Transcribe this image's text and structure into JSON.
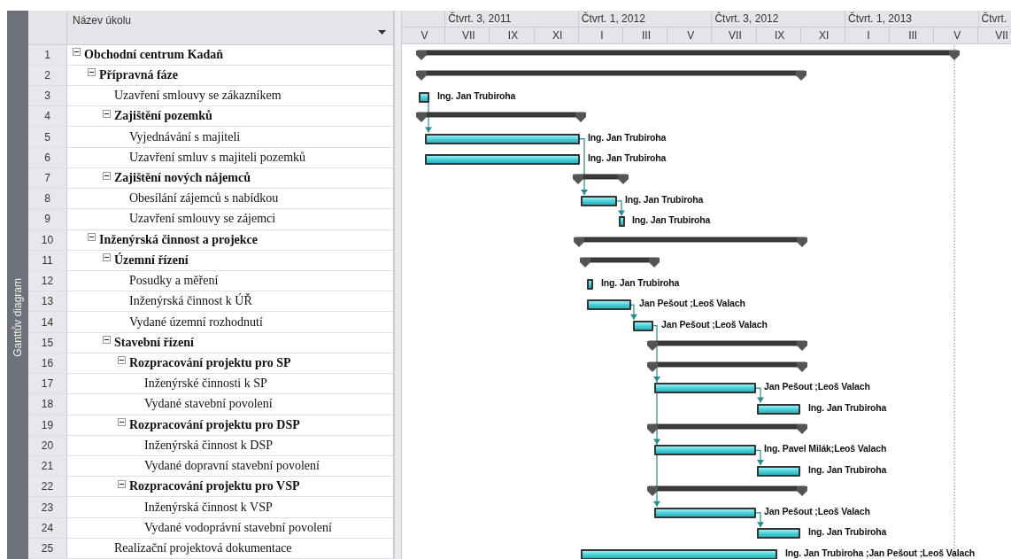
{
  "sidebar": {
    "label": "Ganttův diagram"
  },
  "table": {
    "columns": [
      {
        "label": "Název úkolu"
      }
    ]
  },
  "timeline": {
    "quarters": [
      "Čtvrt. 3, 2011",
      "Čtvrt. 1, 2012",
      "Čtvrt. 3, 2012",
      "Čtvrt. 1, 2013",
      "Čtvrt."
    ],
    "months": [
      "V",
      "VII",
      "IX",
      "XI",
      "I",
      "III",
      "V",
      "VII",
      "IX",
      "XI",
      "I",
      "III",
      "V",
      "VII"
    ]
  },
  "tasks": [
    {
      "id": "1",
      "name": "Obchodní centrum Kadaň",
      "kind": "summary",
      "expanded": true,
      "children": [
        {
          "id": "2",
          "name": "Přípravná fáze",
          "kind": "summary",
          "expanded": true,
          "children": [
            {
              "id": "3",
              "name": "Uzavření smlouvy se zákazníkem",
              "kind": "task",
              "resources": "Ing. Jan Trubiroha"
            },
            {
              "id": "4",
              "name": "Zajištění pozemků",
              "kind": "summary",
              "expanded": true,
              "children": [
                {
                  "id": "5",
                  "name": "Vyjednávání s majiteli",
                  "kind": "task",
                  "resources": "Ing. Jan Trubiroha"
                },
                {
                  "id": "6",
                  "name": "Uzavření smluv s majiteli pozemků",
                  "kind": "task",
                  "resources": "Ing. Jan Trubiroha"
                }
              ]
            },
            {
              "id": "7",
              "name": "Zajištění nových nájemců",
              "kind": "summary",
              "expanded": true,
              "children": [
                {
                  "id": "8",
                  "name": "Obesílání zájemců s nabídkou",
                  "kind": "task",
                  "resources": "Ing. Jan Trubiroha"
                },
                {
                  "id": "9",
                  "name": "Uzavření smlouvy se zájemci",
                  "kind": "task",
                  "resources": "Ing. Jan Trubiroha"
                }
              ]
            }
          ]
        },
        {
          "id": "10",
          "name": "Inženýrská činnost a projekce",
          "kind": "summary",
          "expanded": true,
          "children": [
            {
              "id": "11",
              "name": "Územní řízení",
              "kind": "summary",
              "expanded": true,
              "children": [
                {
                  "id": "12",
                  "name": "Posudky a měření",
                  "kind": "task",
                  "resources": "Ing. Jan Trubiroha"
                },
                {
                  "id": "13",
                  "name": "Inženýrská činnost k ÚŘ",
                  "kind": "task",
                  "resources": "Jan Pešout ;Leoš Valach"
                },
                {
                  "id": "14",
                  "name": "Vydané územní rozhodnutí",
                  "kind": "task",
                  "resources": "Jan Pešout ;Leoš Valach"
                }
              ]
            },
            {
              "id": "15",
              "name": "Stavební řízení",
              "kind": "summary",
              "expanded": true,
              "children": [
                {
                  "id": "16",
                  "name": "Rozpracování projektu pro SP",
                  "kind": "summary",
                  "expanded": true,
                  "children": [
                    {
                      "id": "17",
                      "name": "Inženýrské činnosti k SP",
                      "kind": "task",
                      "resources": "Jan Pešout ;Leoš Valach"
                    },
                    {
                      "id": "18",
                      "name": "Vydané stavební povolení",
                      "kind": "task",
                      "resources": "Ing. Jan Trubiroha"
                    }
                  ]
                },
                {
                  "id": "19",
                  "name": "Rozpracování projektu pro DSP",
                  "kind": "summary",
                  "expanded": true,
                  "children": [
                    {
                      "id": "20",
                      "name": "Inženýrská činnost k DSP",
                      "kind": "task",
                      "resources": "Ing. Pavel Milák;Leoš Valach"
                    },
                    {
                      "id": "21",
                      "name": "Vydané dopravní stavební povolení",
                      "kind": "task",
                      "resources": "Ing. Jan Trubiroha"
                    }
                  ]
                },
                {
                  "id": "22",
                  "name": "Rozpracování projektu pro VSP",
                  "kind": "summary",
                  "expanded": true,
                  "children": [
                    {
                      "id": "23",
                      "name": "Inženýrská činnost k VSP",
                      "kind": "task",
                      "resources": "Jan Pešout ;Leoš Valach"
                    },
                    {
                      "id": "24",
                      "name": "Vydané vodoprávní stavební povolení",
                      "kind": "task",
                      "resources": "Ing. Jan Trubiroha"
                    }
                  ]
                }
              ]
            },
            {
              "id": "25",
              "name": "Realizační projektová dokumentace",
              "kind": "task",
              "resources": "Ing. Jan Trubiroha ;Jan Pešout ;Leoš Valach"
            }
          ]
        }
      ]
    }
  ]
}
